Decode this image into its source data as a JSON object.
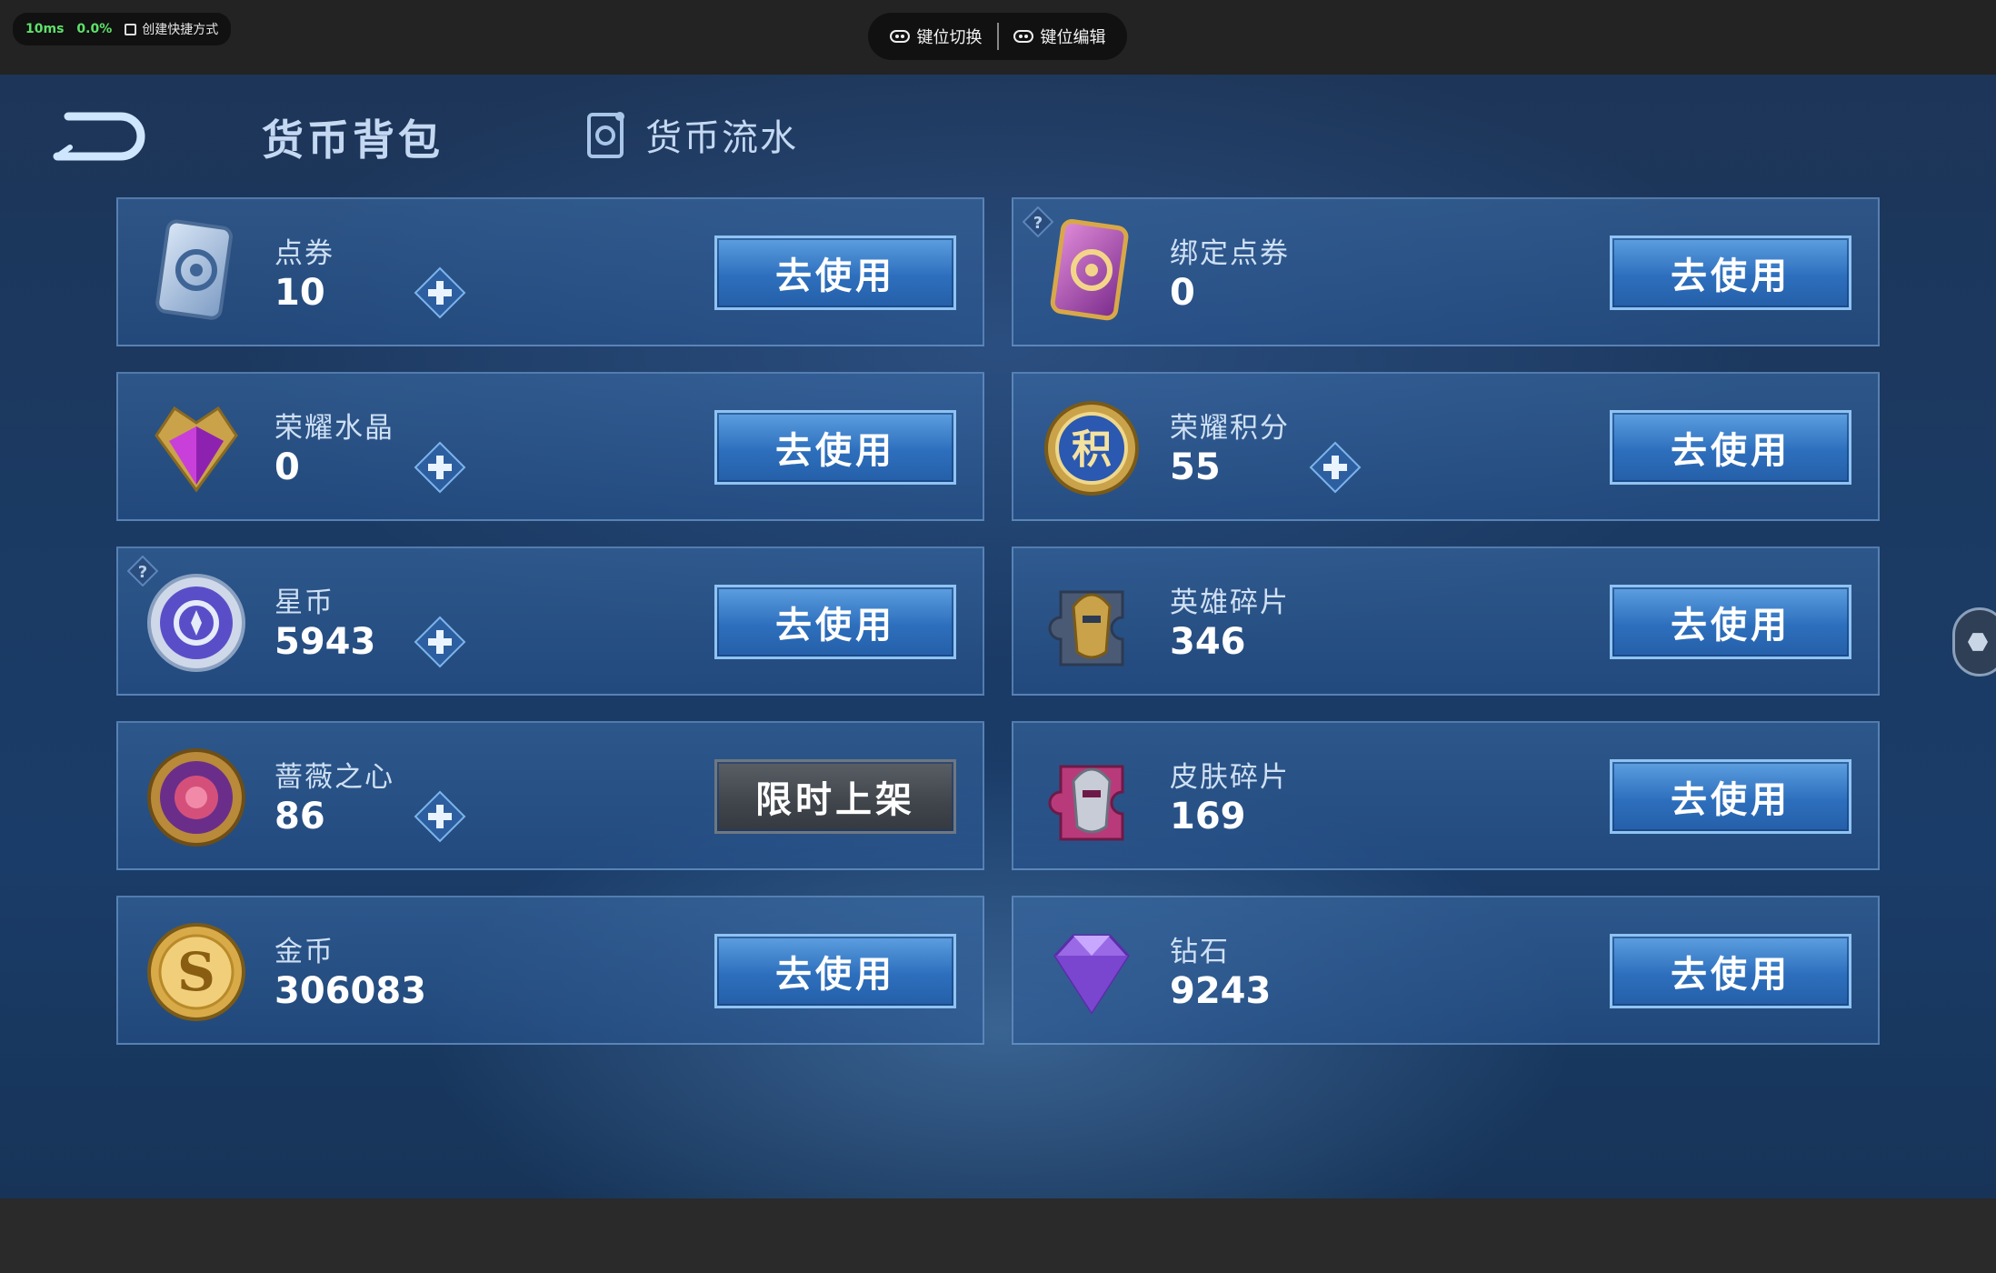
{
  "window": {
    "latency": "10ms",
    "loss": "0.0%",
    "create_shortcut": "创建快捷方式",
    "key_switch": "键位切换",
    "key_edit": "键位编辑"
  },
  "header": {
    "title": "货币背包",
    "tab_flow": "货币流水"
  },
  "cards": [
    {
      "name": "点券",
      "amount": "10",
      "button": "去使用",
      "icon": "coupon-card-icon",
      "plus": true,
      "help": false
    },
    {
      "name": "绑定点券",
      "amount": "0",
      "button": "去使用",
      "icon": "bound-coupon-card-icon",
      "plus": false,
      "help": true
    },
    {
      "name": "荣耀水晶",
      "amount": "0",
      "button": "去使用",
      "icon": "glory-crystal-icon",
      "plus": true,
      "help": false
    },
    {
      "name": "荣耀积分",
      "amount": "55",
      "button": "去使用",
      "icon": "glory-points-icon",
      "plus": true,
      "help": false
    },
    {
      "name": "星币",
      "amount": "5943",
      "button": "去使用",
      "icon": "star-coin-icon",
      "plus": true,
      "help": true
    },
    {
      "name": "英雄碎片",
      "amount": "346",
      "button": "去使用",
      "icon": "hero-fragment-icon",
      "plus": false,
      "help": false
    },
    {
      "name": "蔷薇之心",
      "amount": "86",
      "button": "限时上架",
      "icon": "rose-heart-icon",
      "plus": true,
      "help": false
    },
    {
      "name": "皮肤碎片",
      "amount": "169",
      "button": "去使用",
      "icon": "skin-fragment-icon",
      "plus": false,
      "help": false
    },
    {
      "name": "金币",
      "amount": "306083",
      "button": "去使用",
      "icon": "gold-coin-icon",
      "plus": false,
      "help": false
    },
    {
      "name": "钻石",
      "amount": "9243",
      "button": "去使用",
      "icon": "diamond-icon",
      "plus": false,
      "help": false
    }
  ],
  "glory_points_glyph": "积",
  "gold_coin_glyph": "S"
}
